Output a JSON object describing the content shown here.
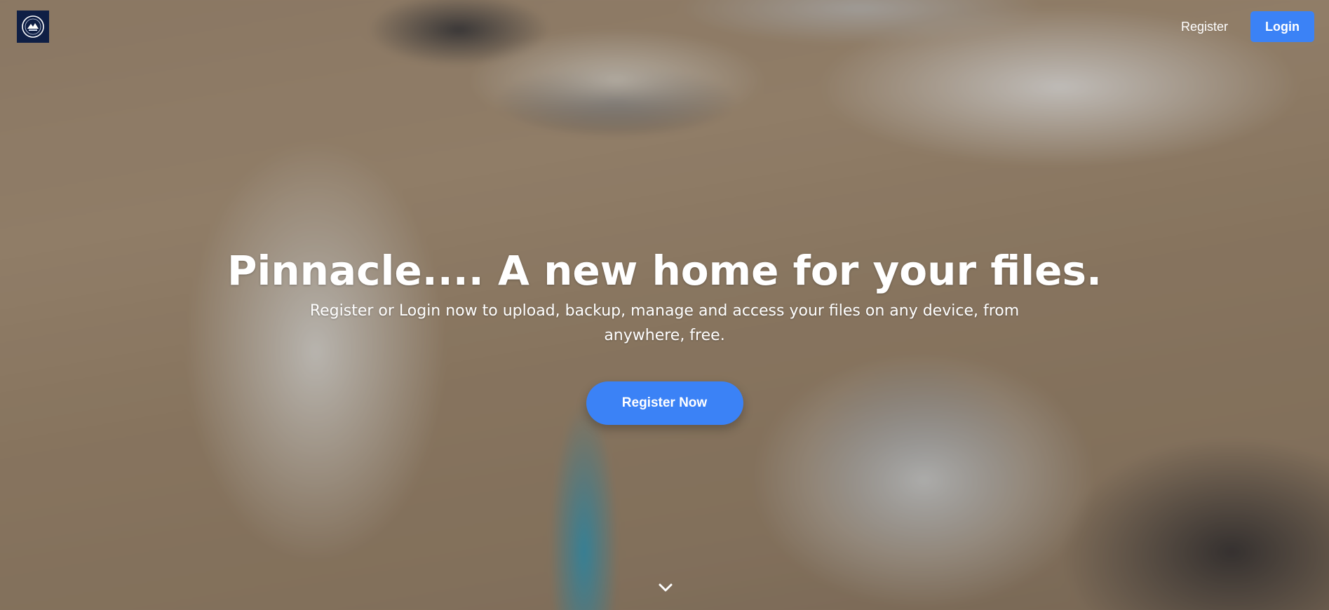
{
  "navbar": {
    "logo_icon": "circle-emblem-logo",
    "register_label": "Register",
    "login_label": "Login"
  },
  "hero": {
    "title": "Pinnacle.... A new home for your files.",
    "subtitle": "Register or Login now to upload, backup, manage and access your files on any device, from anywhere, free.",
    "cta_label": "Register Now",
    "scroll_icon": "chevron-down-icon"
  },
  "colors": {
    "accent": "#3b82f6",
    "logo_bg": "#0f1f45",
    "text": "#ffffff"
  }
}
